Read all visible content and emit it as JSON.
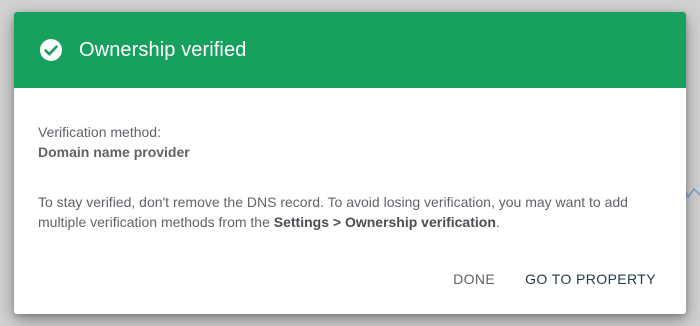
{
  "dialog": {
    "title": "Ownership verified",
    "header_color": "#18a05e",
    "method_label": "Verification method:",
    "method_value": "Domain name provider",
    "message_prefix": "To stay verified, don't remove the DNS record. To avoid losing verification, you may want to add multiple verification methods from the ",
    "message_link": "Settings > Ownership verification",
    "message_suffix": ".",
    "done_label": "DONE",
    "go_label": "GO TO PROPERTY",
    "icon": "check-circle-icon"
  }
}
